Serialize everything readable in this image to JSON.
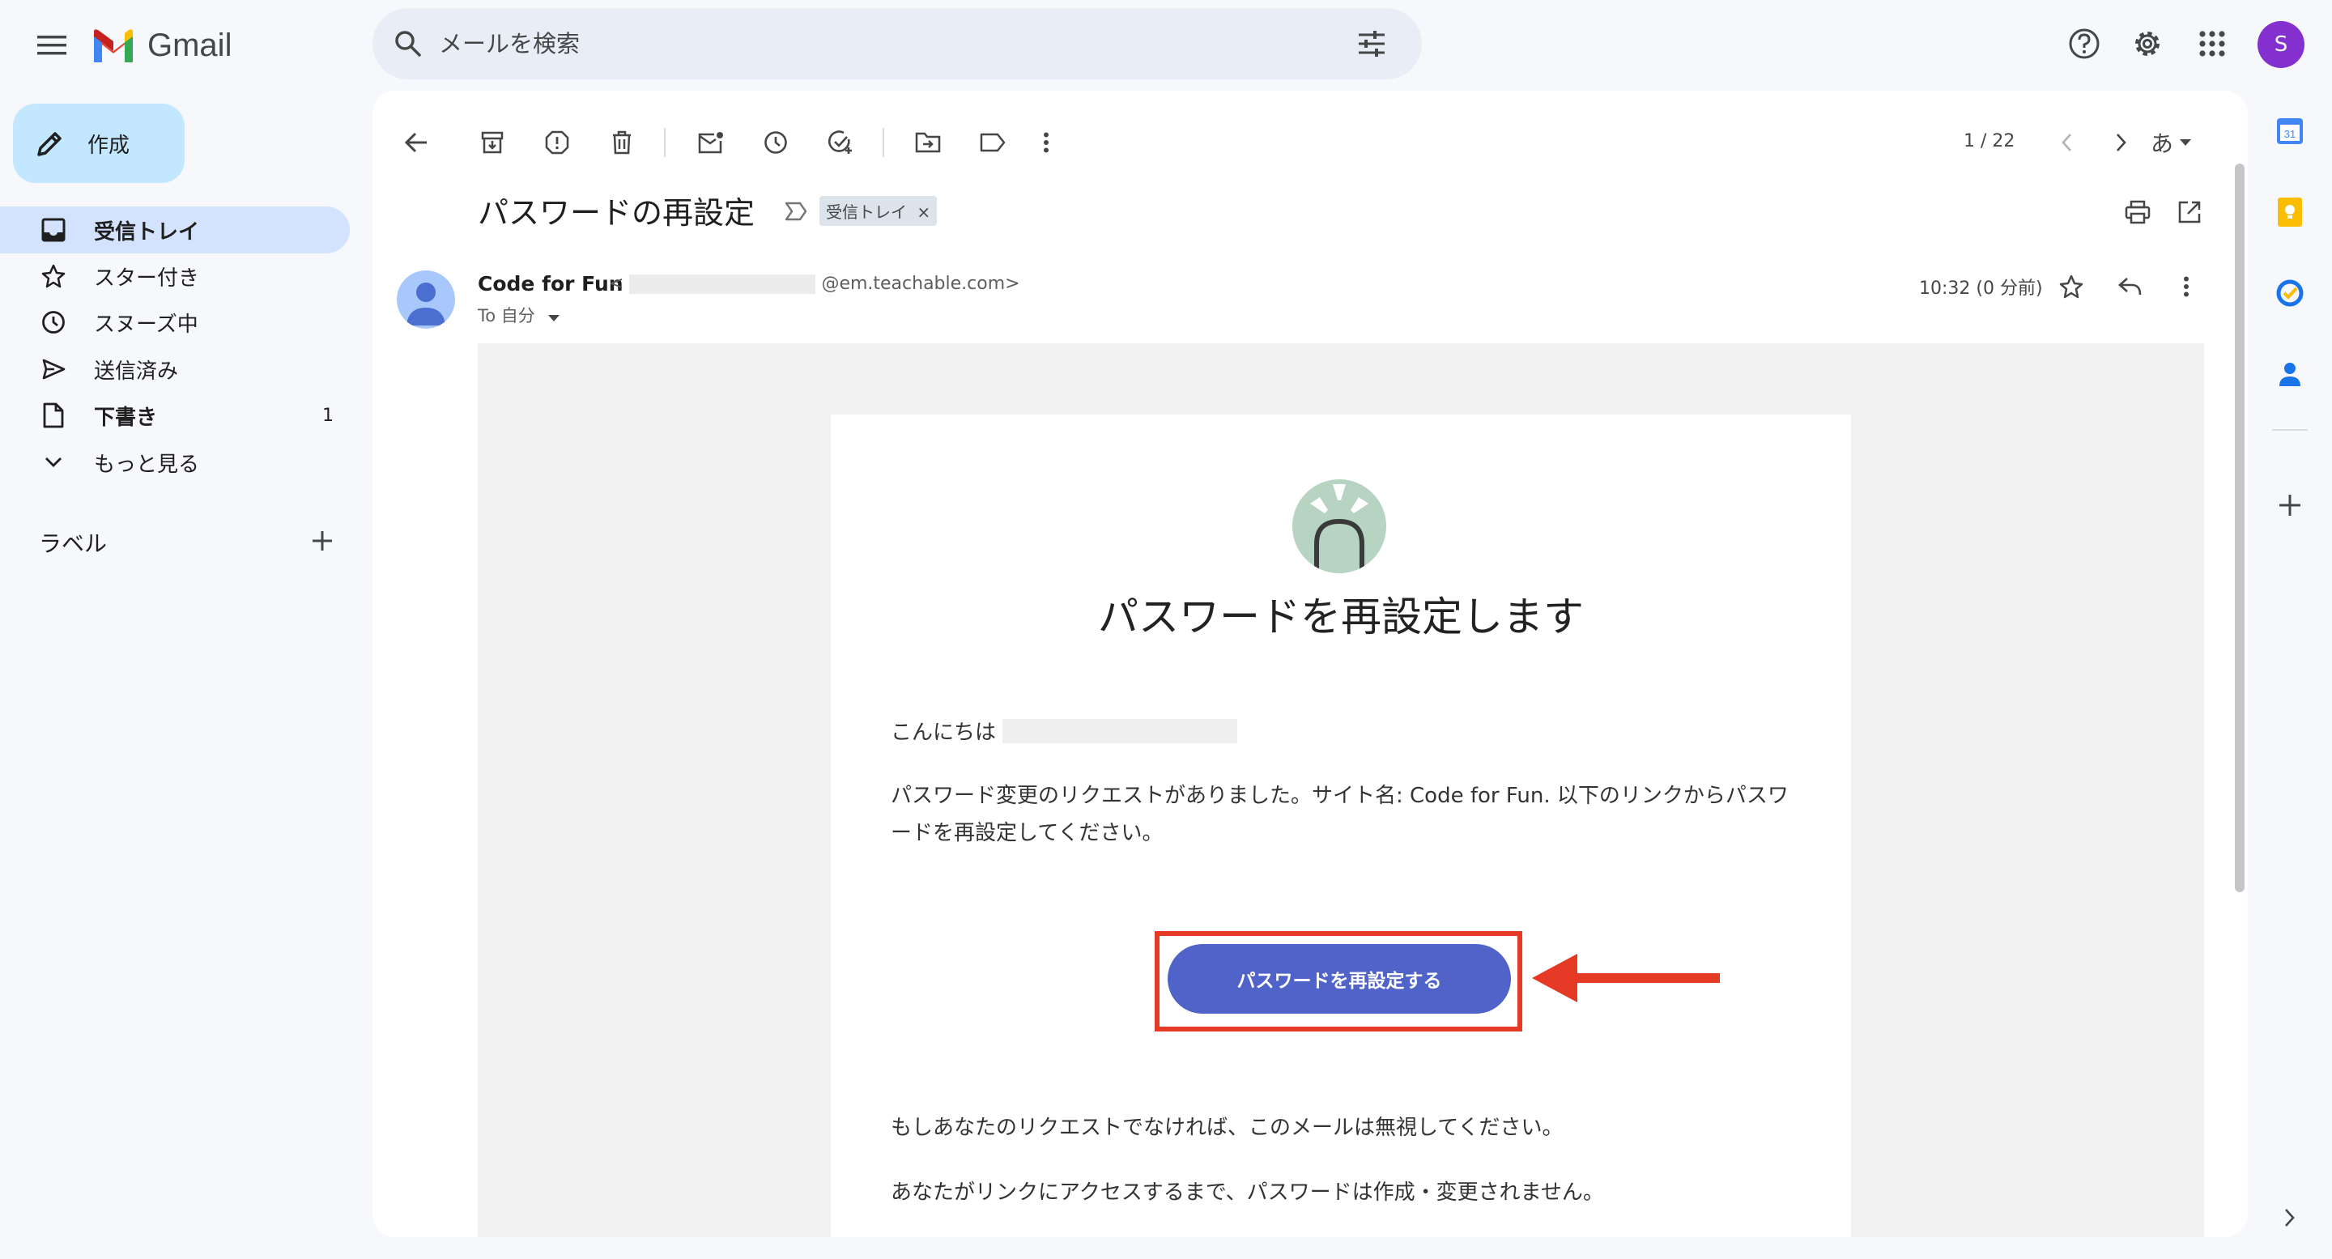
{
  "app": {
    "name": "Gmail"
  },
  "search": {
    "placeholder": "メールを検索"
  },
  "sidebar": {
    "compose_label": "作成",
    "items": [
      {
        "label": "受信トレイ",
        "active": true
      },
      {
        "label": "スター付き"
      },
      {
        "label": "スヌーズ中"
      },
      {
        "label": "送信済み"
      },
      {
        "label": "下書き",
        "count": "1"
      },
      {
        "label": "もっと見る"
      }
    ],
    "labels_heading": "ラベル"
  },
  "toolbar": {
    "pager": "1 / 22",
    "input_tool": "あ"
  },
  "message": {
    "subject": "パスワードの再設定",
    "label_chip": "受信トレイ",
    "label_chip_close": "×",
    "sender_name": "Code for Fun",
    "sender_email_prefix": "<",
    "sender_email_suffix": "@em.teachable.com>",
    "to": "To 自分",
    "time": "10:32 (0 分前)"
  },
  "email_body": {
    "title": "パスワードを再設定します",
    "greeting": "こんにちは",
    "paragraph1": "パスワード変更のリクエストがありました。サイト名: Code for Fun. 以下のリンクからパスワードを再設定してください。",
    "button_label": "パスワードを再設定する",
    "paragraph2": "もしあなたのリクエストでなければ、このメールは無視してください。",
    "paragraph3": "あなたがリンクにアクセスするまで、パスワードは作成・変更されません。"
  },
  "avatar": {
    "initial": "S",
    "color": "#8430ce"
  },
  "calendar_day": "31",
  "colors": {
    "background": "#f6f8fc",
    "search_bg": "#e9eef6",
    "compose_bg": "#c2e7ff",
    "active_nav": "#d3e3fd",
    "cta_button": "#4f63c9",
    "highlight_red": "#e53a25"
  }
}
